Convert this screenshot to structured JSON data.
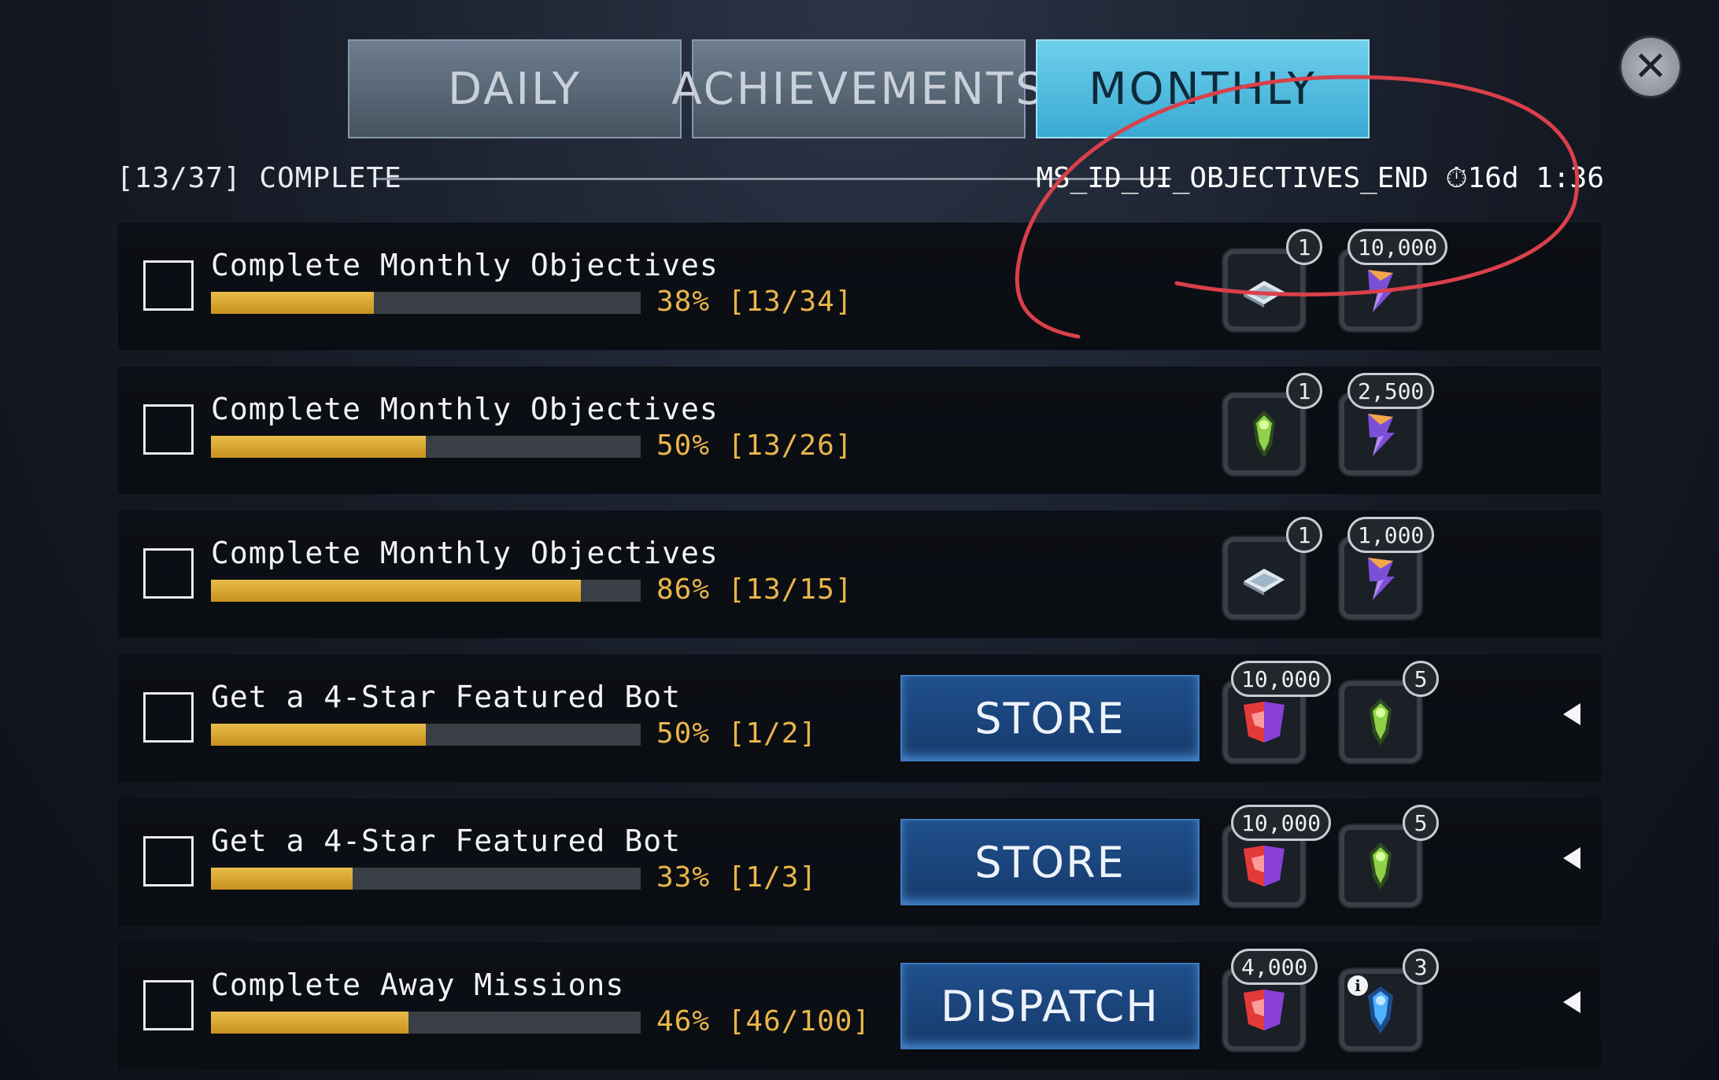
{
  "tabs": [
    {
      "label": "DAILY",
      "active": false
    },
    {
      "label": "ACHIEVEMENTS",
      "active": false
    },
    {
      "label": "MONTHLY",
      "active": true
    }
  ],
  "close_icon": "close-icon",
  "status": {
    "complete_text": "[13/37] COMPLETE",
    "end_label": "MS_ID_UI_OBJECTIVES_END",
    "timer_icon": "stopwatch-icon",
    "time_left": "16d 1:36"
  },
  "objectives": [
    {
      "title": "Complete Monthly Objectives",
      "percent": 38,
      "progress_text": "38%  [13/34]",
      "action": "",
      "rewards": [
        {
          "icon": "blueprint-chip-icon",
          "count": "1"
        },
        {
          "icon": "energon-shard-icon",
          "count": "10,000"
        }
      ]
    },
    {
      "title": "Complete Monthly Objectives",
      "percent": 50,
      "progress_text": "50%  [13/26]",
      "action": "",
      "rewards": [
        {
          "icon": "green-bot-shard-icon",
          "count": "1"
        },
        {
          "icon": "energon-shard-icon",
          "count": "2,500"
        }
      ]
    },
    {
      "title": "Complete Monthly Objectives",
      "percent": 86,
      "progress_text": "86%  [13/15]",
      "action": "",
      "rewards": [
        {
          "icon": "blueprint-chip-icon",
          "count": "1"
        },
        {
          "icon": "energon-shard-icon",
          "count": "1,000"
        }
      ]
    },
    {
      "title": "Get a 4-Star Featured Bot",
      "percent": 50,
      "progress_text": "50%  [1/2]",
      "action": "STORE",
      "rewards": [
        {
          "icon": "faction-coin-icon",
          "count": "10,000"
        },
        {
          "icon": "green-bot-shard-icon",
          "count": "5"
        }
      ]
    },
    {
      "title": "Get a 4-Star Featured Bot",
      "percent": 33,
      "progress_text": "33%  [1/3]",
      "action": "STORE",
      "rewards": [
        {
          "icon": "faction-coin-icon",
          "count": "10,000"
        },
        {
          "icon": "green-bot-shard-icon",
          "count": "5"
        }
      ]
    },
    {
      "title": "Complete Away Missions",
      "percent": 46,
      "progress_text": "46%  [46/100]",
      "action": "DISPATCH",
      "rewards": [
        {
          "icon": "faction-coin-icon",
          "count": "4,000"
        },
        {
          "icon": "blue-bot-shard-icon",
          "count": "3"
        }
      ]
    }
  ],
  "colors": {
    "progress_fill": "#d8a534",
    "progress_text": "#e9b64a",
    "active_tab": "#4fbde0",
    "action_button": "#1c4680",
    "annotation_circle": "#d9404a"
  }
}
